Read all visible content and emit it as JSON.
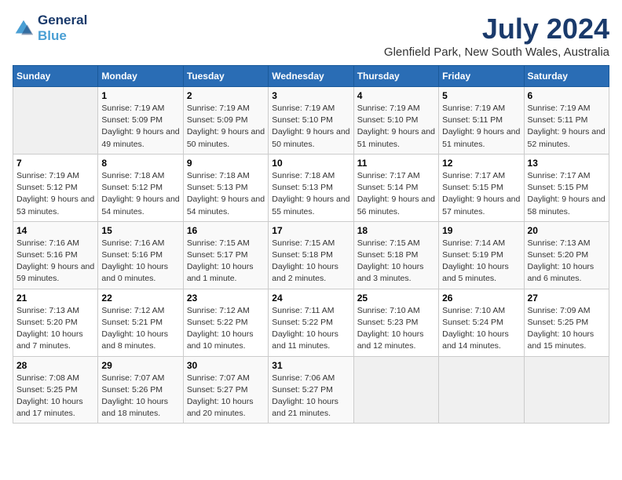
{
  "logo": {
    "line1": "General",
    "line2": "Blue"
  },
  "title": "July 2024",
  "location": "Glenfield Park, New South Wales, Australia",
  "days_of_week": [
    "Sunday",
    "Monday",
    "Tuesday",
    "Wednesday",
    "Thursday",
    "Friday",
    "Saturday"
  ],
  "weeks": [
    [
      {
        "day": "",
        "sunrise": "",
        "sunset": "",
        "daylight": ""
      },
      {
        "day": "1",
        "sunrise": "Sunrise: 7:19 AM",
        "sunset": "Sunset: 5:09 PM",
        "daylight": "Daylight: 9 hours and 49 minutes."
      },
      {
        "day": "2",
        "sunrise": "Sunrise: 7:19 AM",
        "sunset": "Sunset: 5:09 PM",
        "daylight": "Daylight: 9 hours and 50 minutes."
      },
      {
        "day": "3",
        "sunrise": "Sunrise: 7:19 AM",
        "sunset": "Sunset: 5:10 PM",
        "daylight": "Daylight: 9 hours and 50 minutes."
      },
      {
        "day": "4",
        "sunrise": "Sunrise: 7:19 AM",
        "sunset": "Sunset: 5:10 PM",
        "daylight": "Daylight: 9 hours and 51 minutes."
      },
      {
        "day": "5",
        "sunrise": "Sunrise: 7:19 AM",
        "sunset": "Sunset: 5:11 PM",
        "daylight": "Daylight: 9 hours and 51 minutes."
      },
      {
        "day": "6",
        "sunrise": "Sunrise: 7:19 AM",
        "sunset": "Sunset: 5:11 PM",
        "daylight": "Daylight: 9 hours and 52 minutes."
      }
    ],
    [
      {
        "day": "7",
        "sunrise": "Sunrise: 7:19 AM",
        "sunset": "Sunset: 5:12 PM",
        "daylight": "Daylight: 9 hours and 53 minutes."
      },
      {
        "day": "8",
        "sunrise": "Sunrise: 7:18 AM",
        "sunset": "Sunset: 5:12 PM",
        "daylight": "Daylight: 9 hours and 54 minutes."
      },
      {
        "day": "9",
        "sunrise": "Sunrise: 7:18 AM",
        "sunset": "Sunset: 5:13 PM",
        "daylight": "Daylight: 9 hours and 54 minutes."
      },
      {
        "day": "10",
        "sunrise": "Sunrise: 7:18 AM",
        "sunset": "Sunset: 5:13 PM",
        "daylight": "Daylight: 9 hours and 55 minutes."
      },
      {
        "day": "11",
        "sunrise": "Sunrise: 7:17 AM",
        "sunset": "Sunset: 5:14 PM",
        "daylight": "Daylight: 9 hours and 56 minutes."
      },
      {
        "day": "12",
        "sunrise": "Sunrise: 7:17 AM",
        "sunset": "Sunset: 5:15 PM",
        "daylight": "Daylight: 9 hours and 57 minutes."
      },
      {
        "day": "13",
        "sunrise": "Sunrise: 7:17 AM",
        "sunset": "Sunset: 5:15 PM",
        "daylight": "Daylight: 9 hours and 58 minutes."
      }
    ],
    [
      {
        "day": "14",
        "sunrise": "Sunrise: 7:16 AM",
        "sunset": "Sunset: 5:16 PM",
        "daylight": "Daylight: 9 hours and 59 minutes."
      },
      {
        "day": "15",
        "sunrise": "Sunrise: 7:16 AM",
        "sunset": "Sunset: 5:16 PM",
        "daylight": "Daylight: 10 hours and 0 minutes."
      },
      {
        "day": "16",
        "sunrise": "Sunrise: 7:15 AM",
        "sunset": "Sunset: 5:17 PM",
        "daylight": "Daylight: 10 hours and 1 minute."
      },
      {
        "day": "17",
        "sunrise": "Sunrise: 7:15 AM",
        "sunset": "Sunset: 5:18 PM",
        "daylight": "Daylight: 10 hours and 2 minutes."
      },
      {
        "day": "18",
        "sunrise": "Sunrise: 7:15 AM",
        "sunset": "Sunset: 5:18 PM",
        "daylight": "Daylight: 10 hours and 3 minutes."
      },
      {
        "day": "19",
        "sunrise": "Sunrise: 7:14 AM",
        "sunset": "Sunset: 5:19 PM",
        "daylight": "Daylight: 10 hours and 5 minutes."
      },
      {
        "day": "20",
        "sunrise": "Sunrise: 7:13 AM",
        "sunset": "Sunset: 5:20 PM",
        "daylight": "Daylight: 10 hours and 6 minutes."
      }
    ],
    [
      {
        "day": "21",
        "sunrise": "Sunrise: 7:13 AM",
        "sunset": "Sunset: 5:20 PM",
        "daylight": "Daylight: 10 hours and 7 minutes."
      },
      {
        "day": "22",
        "sunrise": "Sunrise: 7:12 AM",
        "sunset": "Sunset: 5:21 PM",
        "daylight": "Daylight: 10 hours and 8 minutes."
      },
      {
        "day": "23",
        "sunrise": "Sunrise: 7:12 AM",
        "sunset": "Sunset: 5:22 PM",
        "daylight": "Daylight: 10 hours and 10 minutes."
      },
      {
        "day": "24",
        "sunrise": "Sunrise: 7:11 AM",
        "sunset": "Sunset: 5:22 PM",
        "daylight": "Daylight: 10 hours and 11 minutes."
      },
      {
        "day": "25",
        "sunrise": "Sunrise: 7:10 AM",
        "sunset": "Sunset: 5:23 PM",
        "daylight": "Daylight: 10 hours and 12 minutes."
      },
      {
        "day": "26",
        "sunrise": "Sunrise: 7:10 AM",
        "sunset": "Sunset: 5:24 PM",
        "daylight": "Daylight: 10 hours and 14 minutes."
      },
      {
        "day": "27",
        "sunrise": "Sunrise: 7:09 AM",
        "sunset": "Sunset: 5:25 PM",
        "daylight": "Daylight: 10 hours and 15 minutes."
      }
    ],
    [
      {
        "day": "28",
        "sunrise": "Sunrise: 7:08 AM",
        "sunset": "Sunset: 5:25 PM",
        "daylight": "Daylight: 10 hours and 17 minutes."
      },
      {
        "day": "29",
        "sunrise": "Sunrise: 7:07 AM",
        "sunset": "Sunset: 5:26 PM",
        "daylight": "Daylight: 10 hours and 18 minutes."
      },
      {
        "day": "30",
        "sunrise": "Sunrise: 7:07 AM",
        "sunset": "Sunset: 5:27 PM",
        "daylight": "Daylight: 10 hours and 20 minutes."
      },
      {
        "day": "31",
        "sunrise": "Sunrise: 7:06 AM",
        "sunset": "Sunset: 5:27 PM",
        "daylight": "Daylight: 10 hours and 21 minutes."
      },
      {
        "day": "",
        "sunrise": "",
        "sunset": "",
        "daylight": ""
      },
      {
        "day": "",
        "sunrise": "",
        "sunset": "",
        "daylight": ""
      },
      {
        "day": "",
        "sunrise": "",
        "sunset": "",
        "daylight": ""
      }
    ]
  ]
}
